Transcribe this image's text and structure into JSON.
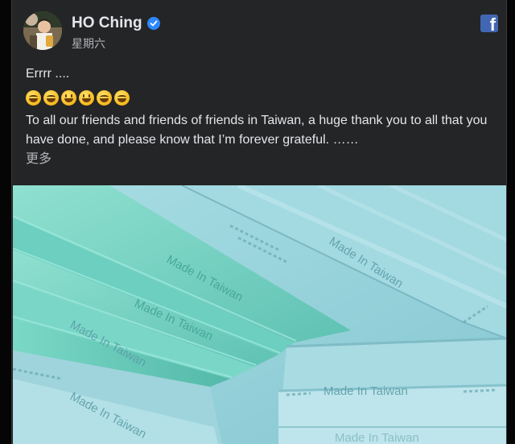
{
  "post": {
    "author": "HO Ching",
    "timestamp": "星期六",
    "text_line1": "Errrr ....",
    "emoji": [
      "😄",
      "😄",
      "😃",
      "😃",
      "😄",
      "😄"
    ],
    "paragraph": "To all our friends and friends of friends in Taiwan, a huge thank you to all that you have done, and please know that I’m forever grateful. ……",
    "see_more": "更多"
  },
  "photo": {
    "embossed_labels": [
      "Made In Taiwan",
      "Made In Taiwan",
      "Made In Taiwan",
      "Made In Taiwan",
      "Made In Taiwan",
      "Made In Taiwan",
      "Made In Taiwan"
    ]
  },
  "colors": {
    "card_bg": "#242526",
    "text_primary": "#e4e6eb",
    "text_secondary": "#b0b3b8",
    "verified_blue": "#2d88ff",
    "facebook_blue": "#4267b2",
    "mask_teal": "#7fd3c8",
    "mask_blue": "#9fd6de"
  },
  "icons": {
    "verified": "verified-badge-icon",
    "facebook": "facebook-logo-icon"
  }
}
